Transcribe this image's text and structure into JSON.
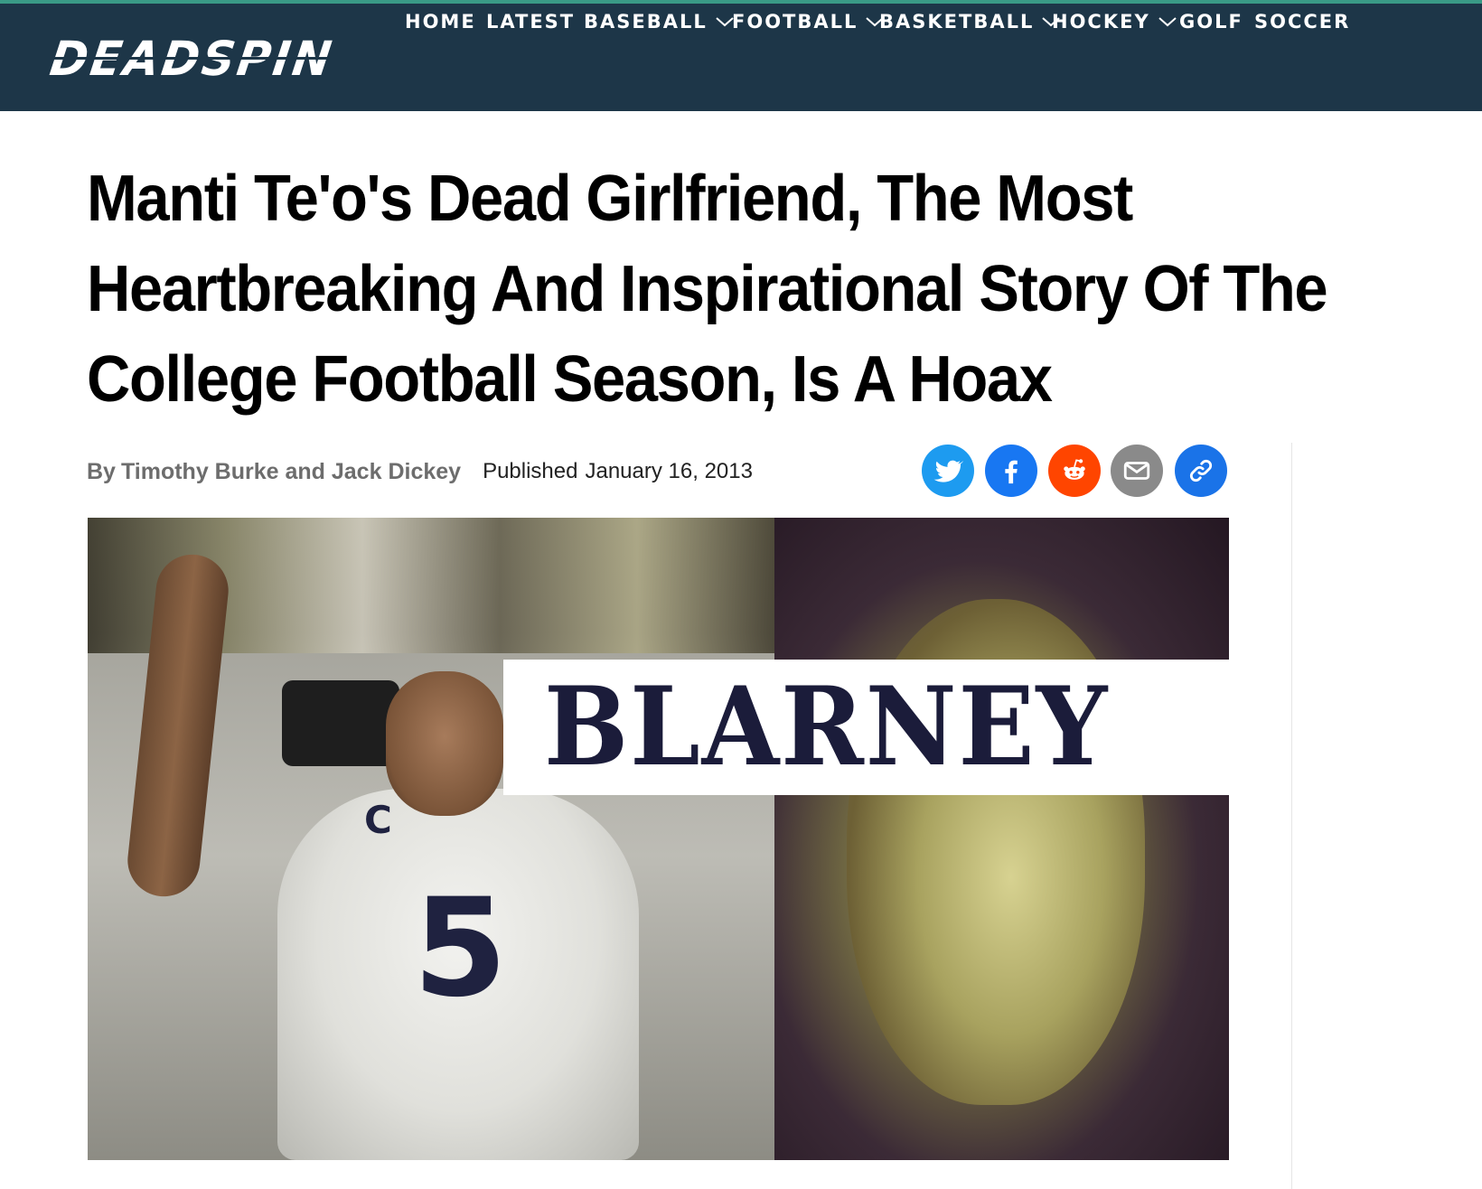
{
  "site": {
    "logo_text": "DEADSPIN",
    "colors": {
      "nav_bg": "#1d3648",
      "accent_line": "#3a9a86",
      "twitter": "#1d9bf0",
      "facebook": "#1877f2",
      "reddit": "#ff4500",
      "email": "#8a8a8a",
      "link": "#1a73e8"
    }
  },
  "nav": {
    "items": [
      {
        "label": "HOME",
        "has_dropdown": false
      },
      {
        "label": "LATEST",
        "has_dropdown": false
      },
      {
        "label": "BASEBALL",
        "has_dropdown": true
      },
      {
        "label": "FOOTBALL",
        "has_dropdown": true
      },
      {
        "label": "BASKETBALL",
        "has_dropdown": true
      },
      {
        "label": "HOCKEY",
        "has_dropdown": true
      },
      {
        "label": "GOLF",
        "has_dropdown": false
      },
      {
        "label": "SOCCER",
        "has_dropdown": false
      }
    ]
  },
  "article": {
    "headline": "Manti Te'o's Dead Girlfriend, The Most Heartbreaking And Inspirational Story Of The College Football Season, Is A Hoax",
    "headline_lines": [
      "Manti Te'o's Dead Girlfriend, The Most",
      "Heartbreaking And Inspirational Story Of The",
      "College Football Season, Is A Hoax"
    ],
    "byline_prefix": "By",
    "authors": "Timothy Burke and Jack Dickey",
    "published_label": "Published",
    "published_date": "January 16, 2013"
  },
  "share": {
    "buttons": [
      {
        "name": "twitter",
        "icon": "twitter-icon"
      },
      {
        "name": "facebook",
        "icon": "facebook-icon"
      },
      {
        "name": "reddit",
        "icon": "reddit-icon"
      },
      {
        "name": "email",
        "icon": "email-icon"
      },
      {
        "name": "copy-link",
        "icon": "link-icon"
      }
    ]
  },
  "hero_image": {
    "banner_text": "BLARNEY",
    "jersey_number": "5",
    "jersey_letter": "C"
  }
}
